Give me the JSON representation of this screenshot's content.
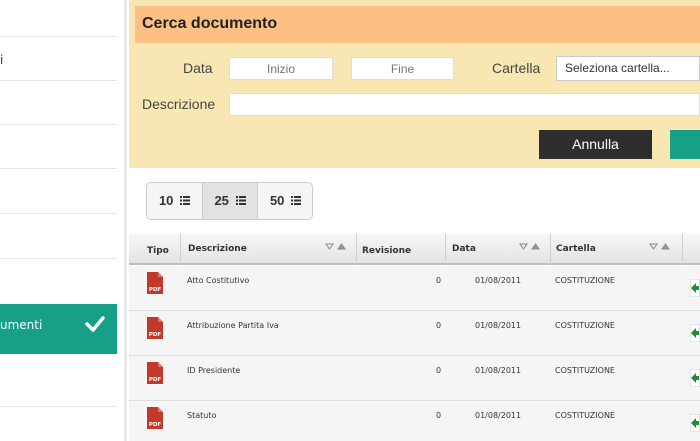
{
  "sidebar": {
    "items": [
      {
        "label": ""
      },
      {
        "label": "i"
      },
      {
        "label": ""
      },
      {
        "label": ""
      },
      {
        "label": ""
      },
      {
        "label": ""
      },
      {
        "label": ""
      }
    ],
    "active_item": {
      "label": "umenti"
    },
    "bottom_item": {
      "label": ""
    }
  },
  "search_panel": {
    "title": "Cerca documento",
    "date_label": "Data",
    "start_placeholder": "Inizio",
    "end_placeholder": "Fine",
    "folder_label": "Cartella",
    "folder_select_value": "Seleziona cartella...",
    "description_label": "Descrizione",
    "description_value": "",
    "cancel_label": "Annulla",
    "confirm_label": ""
  },
  "page_size": {
    "options": [
      {
        "label": "10",
        "active": false
      },
      {
        "label": "25",
        "active": true
      },
      {
        "label": "50",
        "active": false
      }
    ]
  },
  "table": {
    "headers": {
      "type": "Tipo",
      "description": "Descrizione",
      "revision": "Revisione",
      "date": "Data",
      "folder": "Cartella"
    },
    "rows": [
      {
        "type_icon": "pdf-icon",
        "description": "Atto Costitutivo",
        "revision": "0",
        "date": "01/08/2011",
        "folder": "COSTITUZIONE"
      },
      {
        "type_icon": "pdf-icon",
        "description": "Attribuzione Partita Iva",
        "revision": "0",
        "date": "01/08/2011",
        "folder": "COSTITUZIONE"
      },
      {
        "type_icon": "pdf-icon",
        "description": "ID Presidente",
        "revision": "0",
        "date": "01/08/2011",
        "folder": "COSTITUZIONE"
      },
      {
        "type_icon": "pdf-icon",
        "description": "Statuto",
        "revision": "0",
        "date": "01/08/2011",
        "folder": "COSTITUZIONE"
      }
    ]
  },
  "colors": {
    "accent": "#16a085",
    "panel_bg": "#f9e7b3",
    "panel_title_bg": "#fcbf84",
    "dark_button": "#2e2e2e",
    "pdf_red": "#c0392b"
  }
}
